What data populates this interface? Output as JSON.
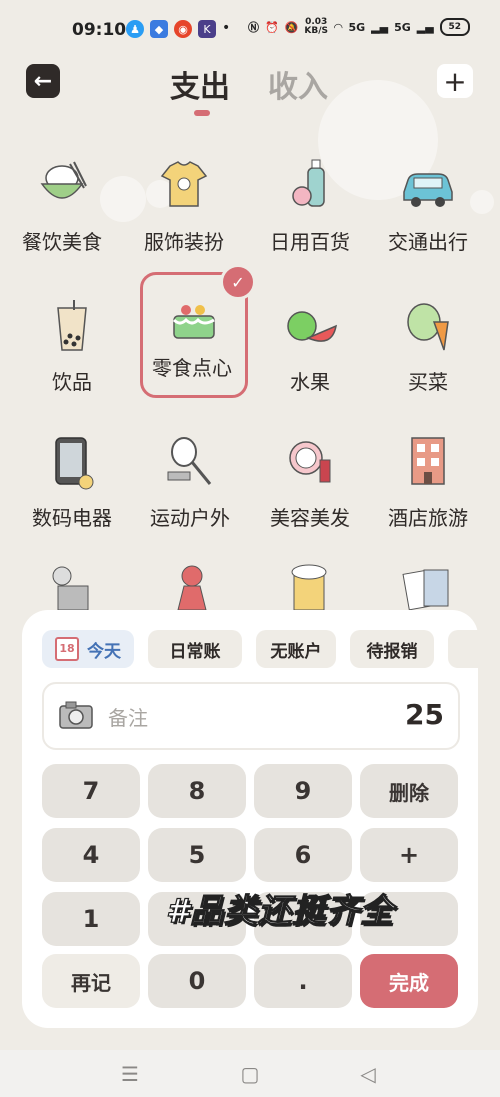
{
  "status_bar": {
    "time": "09:10",
    "net_speed_value": "0.03",
    "net_speed_unit": "KB/S",
    "signal1": "5G",
    "signal2": "5G",
    "battery": "52"
  },
  "header": {
    "tabs": [
      {
        "label": "支出",
        "active": true
      },
      {
        "label": "收入",
        "active": false
      }
    ]
  },
  "categories": [
    {
      "label": "餐饮美食",
      "icon": "rice-bowl-icon"
    },
    {
      "label": "服饰装扮",
      "icon": "tshirt-icon"
    },
    {
      "label": "日用百货",
      "icon": "toiletries-icon"
    },
    {
      "label": "交通出行",
      "icon": "car-icon"
    },
    {
      "label": "饮品",
      "icon": "bubble-tea-icon"
    },
    {
      "label": "零食点心",
      "icon": "cake-icon",
      "selected": true
    },
    {
      "label": "水果",
      "icon": "fruit-icon"
    },
    {
      "label": "买菜",
      "icon": "vegetables-icon"
    },
    {
      "label": "数码电器",
      "icon": "phone-icon"
    },
    {
      "label": "运动户外",
      "icon": "racket-icon"
    },
    {
      "label": "美容美发",
      "icon": "cosmetics-icon"
    },
    {
      "label": "酒店旅游",
      "icon": "hotel-icon"
    }
  ],
  "chips": [
    {
      "label": "今天",
      "icon": "calendar-icon"
    },
    {
      "label": "日常账"
    },
    {
      "label": "无账户"
    },
    {
      "label": "待报销"
    }
  ],
  "note": {
    "placeholder": "备注",
    "amount": "25"
  },
  "keypad": {
    "k7": "7",
    "k8": "8",
    "k9": "9",
    "delete": "删除",
    "k4": "4",
    "k5": "5",
    "k6": "6",
    "plus": "+",
    "k1": "1",
    "again": "再记",
    "k0": "0",
    "dot": ".",
    "done": "完成"
  },
  "overlay_caption": "#品类还挺齐全",
  "colors": {
    "accent": "#d56d74",
    "background": "#efece6",
    "today_chip_text": "#4472b5"
  }
}
